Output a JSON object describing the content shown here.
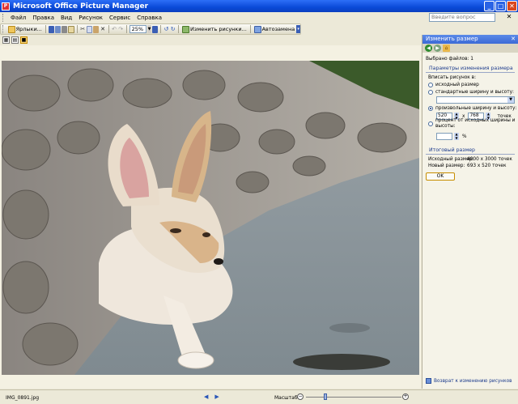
{
  "app": {
    "title": "Microsoft Office Picture Manager",
    "icon_letter": "P"
  },
  "window_buttons": {
    "minimize": "_",
    "maximize": "□",
    "close": "✕"
  },
  "menu": {
    "items": [
      "Файл",
      "Правка",
      "Вид",
      "Рисунок",
      "Сервис",
      "Справка"
    ],
    "ask_placeholder": "Введите вопрос",
    "close_glyph": "✕"
  },
  "toolbar": {
    "shortcuts_label": "Ярлыки...",
    "zoom_value": "25%",
    "edit_label": "Изменить рисунки...",
    "autocorrect_label": "Автозамена"
  },
  "task_pane": {
    "title": "Изменить размер",
    "files_selected": "Выбрано файлов: 1",
    "params_title": "Параметры изменения размера",
    "fit_label": "Вписать рисунок в:",
    "options": [
      {
        "label": "исходный размер",
        "selected": false
      },
      {
        "label": "стандартные ширину и высоту:",
        "selected": false
      },
      {
        "label": "произвольные ширину и высоту:",
        "selected": true
      },
      {
        "label": "процент от исходных ширины и высоты:",
        "selected": false
      }
    ],
    "width_value": "520",
    "x_sep": "x",
    "height_value": "768",
    "points_unit": "точек",
    "percent_unit": "%",
    "result_title": "Итоговый размер",
    "original_size_label": "Исходный размер:",
    "original_size_value": "4000 x 3000 точек",
    "new_size_label": "Новый размер:",
    "new_size_value": "693 x 520 точек",
    "ok_label": "OK",
    "back_link": "Возврат к изменению рисунков"
  },
  "status": {
    "filename": "IMG_0891.jpg",
    "zoom_label": "Масштаб",
    "zoom_level": 0.2
  },
  "colors": {
    "titlebar": "#0a4ad8",
    "pane_header": "#3c6ad6",
    "ok_border": "#c78d00"
  }
}
